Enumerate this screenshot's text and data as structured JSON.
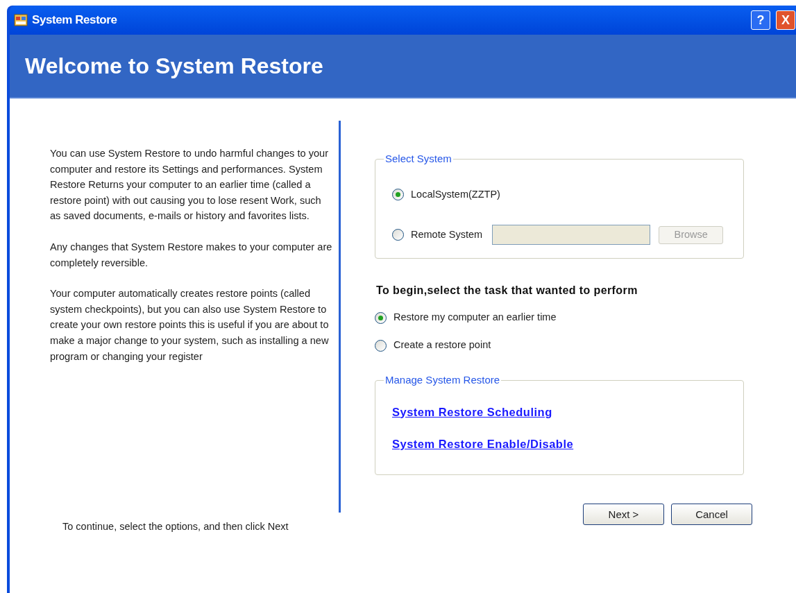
{
  "window": {
    "title": "System Restore",
    "controls": [
      "?",
      "X"
    ]
  },
  "header": {
    "title": "Welcome to System Restore"
  },
  "intro": {
    "paragraphs": [
      "You can use System Restore to undo harmful changes to your computer and restore its Settings and performances. System Restore Returns your computer to an earlier time (called a restore point) with out causing you to lose resent Work, such as saved documents, e-mails or history and favorites lists.",
      "Any changes that System Restore makes to your computer are completely reversible.",
      "Your computer automatically creates restore points (called system checkpoints), but you can also use System Restore to create your own restore points this is useful if you are about to make a major change to your system, such as installing a new program or changing your register"
    ],
    "footer": "To continue, select the options, and then click Next"
  },
  "select_system": {
    "legend": "Select System",
    "options": [
      {
        "label": "LocalSystem(ZZTP)",
        "selected": true
      },
      {
        "label": "Remote System",
        "selected": false
      }
    ],
    "remote_field": {
      "disabled": true
    },
    "browse_button": {
      "label": "Browse",
      "disabled": true
    }
  },
  "task": {
    "heading": "To begin,select the task that wanted to perform",
    "options": [
      {
        "label": "Restore my computer an earlier time",
        "selected": true
      },
      {
        "label": "Create a restore point",
        "selected": false
      }
    ]
  },
  "manage": {
    "legend": "Manage System Restore",
    "links": [
      "System Restore Scheduling",
      "System Restore Enable/Disable"
    ]
  },
  "buttons": [
    "Next >",
    "Cancel"
  ]
}
